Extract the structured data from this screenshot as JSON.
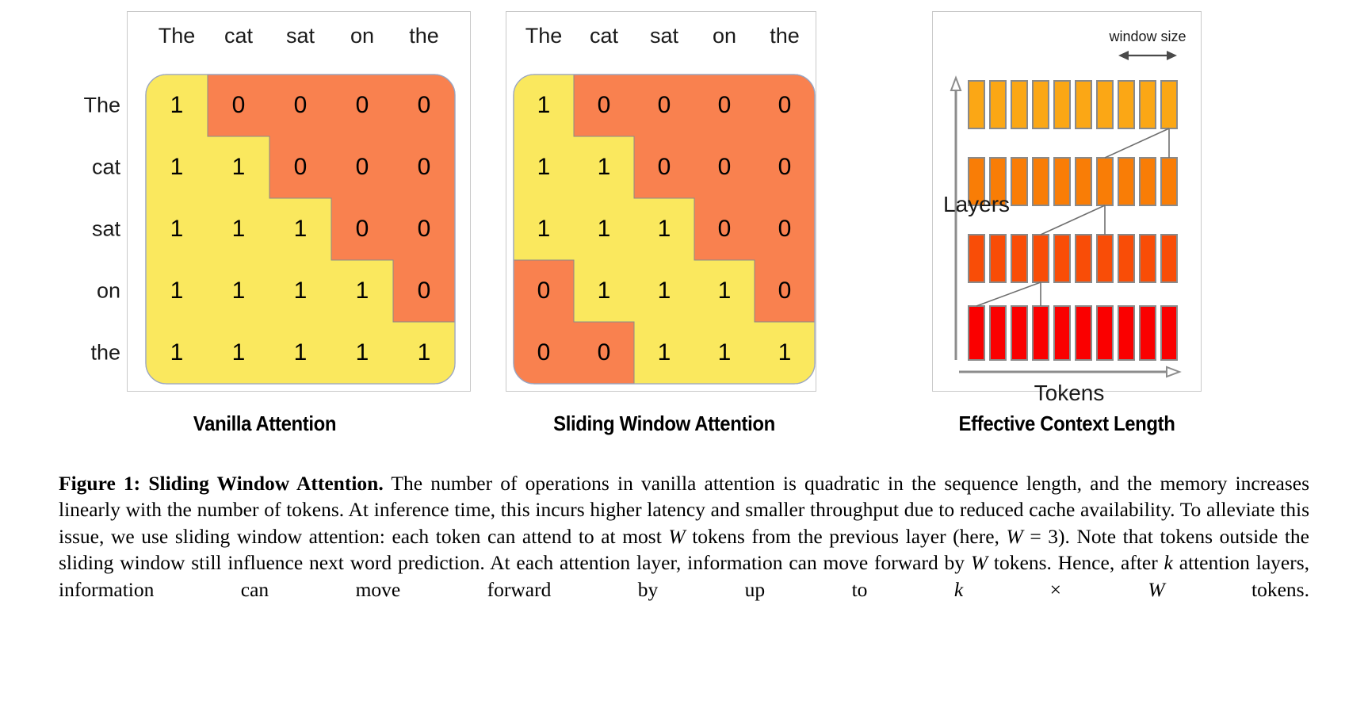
{
  "figure": {
    "label": "Figure 1:",
    "bold_title": "Sliding Window Attention.",
    "body_part_1": " The number of operations in vanilla attention is quadratic in the sequence length, and the memory increases linearly with the number of tokens. At inference time, this incurs higher latency and smaller throughput due to reduced cache availability. To alleviate this issue, we use sliding window attention: each token can attend to at most ",
    "var_W_1": "W",
    "body_part_2": " tokens from the previous layer (here, ",
    "var_W_2": "W",
    "eq_1": " = ",
    "num_3": "3",
    "body_part_3": "). Note that tokens outside the sliding window still influence next word prediction. At each attention layer, information can move forward by ",
    "var_W_3": "W",
    "body_part_4": " tokens. Hence, after ",
    "var_k_1": "k",
    "body_part_5": " attention layers, information can move forward by up to ",
    "var_k_2": "k",
    "times": " × ",
    "var_W_4": "W",
    "body_part_6": " tokens."
  },
  "panels": [
    {
      "id": "vanilla",
      "title": "Vanilla Attention",
      "columns": [
        "The",
        "cat",
        "sat",
        "on",
        "the"
      ],
      "rows": [
        "The",
        "cat",
        "sat",
        "on",
        "the"
      ],
      "matrix": [
        [
          1,
          0,
          0,
          0,
          0
        ],
        [
          1,
          1,
          0,
          0,
          0
        ],
        [
          1,
          1,
          1,
          0,
          0
        ],
        [
          1,
          1,
          1,
          1,
          0
        ],
        [
          1,
          1,
          1,
          1,
          1
        ]
      ],
      "window": 5,
      "show_row_labels": true
    },
    {
      "id": "sliding",
      "title": "Sliding Window Attention",
      "columns": [
        "The",
        "cat",
        "sat",
        "on",
        "the"
      ],
      "rows": [
        "The",
        "cat",
        "sat",
        "on",
        "the"
      ],
      "matrix": [
        [
          1,
          0,
          0,
          0,
          0
        ],
        [
          1,
          1,
          0,
          0,
          0
        ],
        [
          1,
          1,
          1,
          0,
          0
        ],
        [
          0,
          1,
          1,
          1,
          0
        ],
        [
          0,
          0,
          1,
          1,
          1
        ]
      ],
      "window": 3,
      "show_row_labels": false
    }
  ],
  "context_panel": {
    "title": "Effective Context Length",
    "y_axis_label": "Layers",
    "x_axis_label": "Tokens",
    "window_label": "window size",
    "num_layers": 4,
    "tokens_per_layer": 10,
    "window_span_tokens": 3,
    "layer_colors": [
      "#fa0000",
      "#f94d07",
      "#f97d06",
      "#fba715"
    ]
  },
  "colors": {
    "attend_fill": "#fae85e",
    "mask_fill": "#f9814f",
    "mask_stroke": "#8a8a8a",
    "panel_border": "#c9c9c9",
    "axis_gray": "#8c8c8c",
    "text": "#000000",
    "bar_stroke": "#8a8a8a"
  },
  "icons": {
    "window_arrow": "double-arrow-horizontal-icon",
    "layers_arrow": "arrow-up-icon",
    "tokens_arrow": "arrow-right-icon"
  }
}
